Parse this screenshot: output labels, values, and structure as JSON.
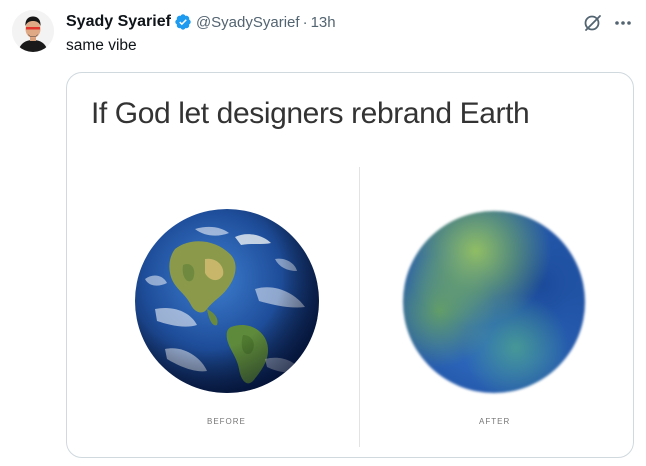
{
  "tweet": {
    "display_name": "Syady Syarief",
    "handle": "@SyadySyarief",
    "separator": "·",
    "time": "13h",
    "text": "same vibe",
    "verified_icon": "verified-badge-icon",
    "grok_icon": "grok-icon",
    "more_icon": "more-horizontal-icon"
  },
  "media": {
    "title": "If God let designers rebrand Earth",
    "before_label": "BEFORE",
    "after_label": "AFTER"
  },
  "colors": {
    "text_primary": "#0f1419",
    "text_secondary": "#536471",
    "verified_blue": "#1d9bf0",
    "card_border": "#cfd9de"
  }
}
